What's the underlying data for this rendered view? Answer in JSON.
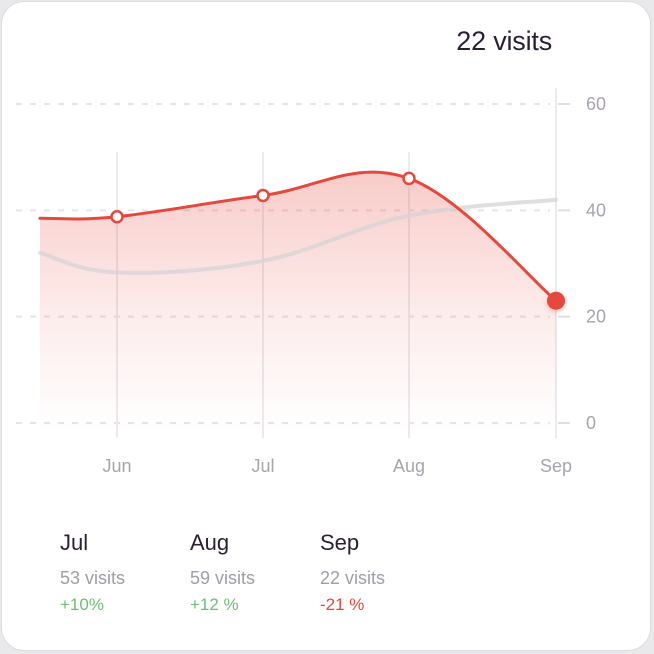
{
  "headline": {
    "value": "22 visits"
  },
  "chart_data": {
    "type": "area",
    "x": [
      "Jun",
      "Jul",
      "Aug",
      "Sep"
    ],
    "y_ticks": [
      "60",
      "40",
      "20",
      "0"
    ],
    "ylim": [
      0,
      60
    ],
    "grid": true,
    "series": [
      {
        "role": "current",
        "color": "#e5483d",
        "points": [
          {
            "x": "start",
            "y": 38.5
          },
          {
            "x": "Jun",
            "y": 38.8
          },
          {
            "x": "Jul",
            "y": 42.8
          },
          {
            "x": "Aug",
            "y": 46
          },
          {
            "x": "Sep",
            "y": 23
          }
        ]
      },
      {
        "role": "comparison",
        "color": "#d6d3d6",
        "points": [
          {
            "x": "start",
            "y": 32
          },
          {
            "x": "Jun",
            "y": 28.3
          },
          {
            "x": "Jul",
            "y": 30.5
          },
          {
            "x": "Aug",
            "y": 39
          },
          {
            "x": "Sep",
            "y": 42
          }
        ]
      }
    ],
    "highlight": {
      "x": "Sep",
      "y": 23
    }
  },
  "stats": [
    {
      "month": "Jul",
      "visits": "53 visits",
      "change": "+10%",
      "trend": "up"
    },
    {
      "month": "Aug",
      "visits": "59 visits",
      "change": "+12 %",
      "trend": "up"
    },
    {
      "month": "Sep",
      "visits": "22 visits",
      "change": "-21 %",
      "trend": "down"
    }
  ],
  "colors": {
    "up": "#6cbf73",
    "down": "#e5483d",
    "accent": "#e5483d"
  }
}
